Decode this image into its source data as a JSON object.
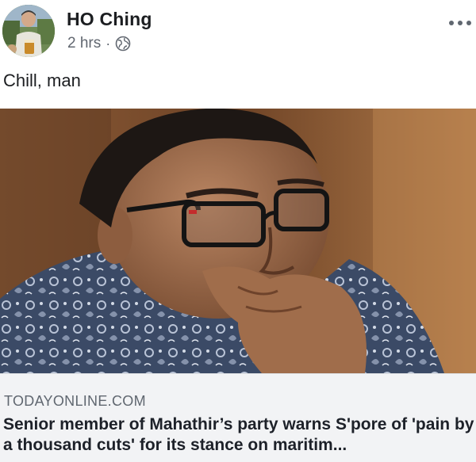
{
  "post": {
    "author": "HO Ching",
    "time": "2 hrs",
    "separator": "·",
    "privacy_icon": "globe-icon",
    "caption": "Chill, man"
  },
  "link_preview": {
    "domain": "TODAYONLINE.COM",
    "headline": "Senior member of Mahathir’s party warns S'pore of 'pain by a thousand cuts' for its stance on maritim..."
  },
  "colors": {
    "name": "#1c1e21",
    "meta": "#616770",
    "link_bg": "#f2f3f5"
  }
}
